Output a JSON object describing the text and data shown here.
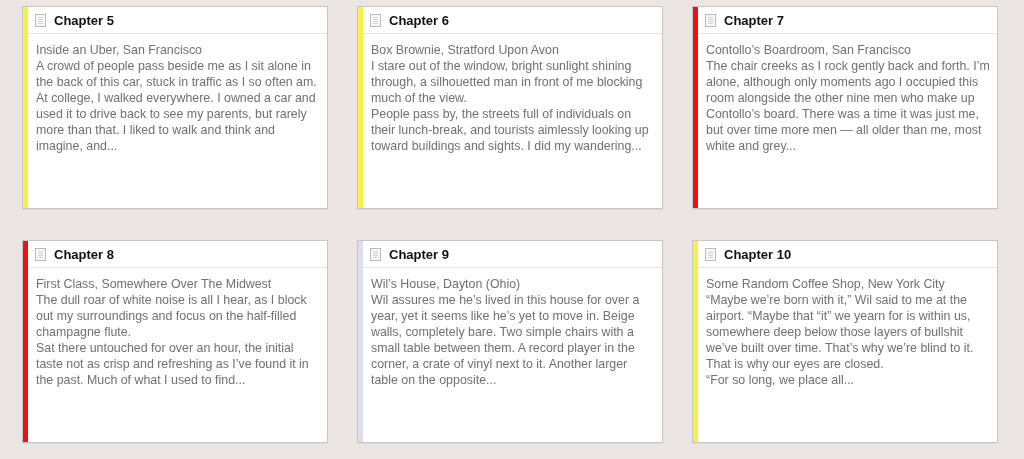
{
  "cards": [
    {
      "title": "Chapter 5",
      "color": "#f7f04a",
      "location": "Inside an Uber, San Francisco",
      "paragraphs": [
        "A crowd of people pass beside me as I sit alone in the back of this car, stuck in traffic as I so often am.",
        "At college, I walked everywhere. I owned a car and used it to drive back to see my parents, but rarely more than that. I liked to walk and think and imagine, and..."
      ]
    },
    {
      "title": "Chapter 6",
      "color": "#f7f04a",
      "location": "Box Brownie, Stratford Upon Avon",
      "paragraphs": [
        "I stare out of the window, bright sunlight shining through, a silhouetted man in front of me blocking much of the view.",
        "People pass by, the streets full of individuals on their lunch-break, and tourists aimlessly looking up toward buildings and sights. I did my wandering..."
      ]
    },
    {
      "title": "Chapter 7",
      "color": "#ef1010",
      "location": "Contollo’s Boardroom, San Francisco",
      "paragraphs": [
        "The chair creeks as I rock gently back and forth. I’m alone, although only moments ago I occupied this room alongside the other nine men who make up Contollo’s board. There was a time it was just me, but over time more men — all older than me, most white and grey..."
      ]
    },
    {
      "title": "Chapter 8",
      "color": "#ef1010",
      "location": "First Class, Somewhere Over The Midwest",
      "paragraphs": [
        "The dull roar of white noise is all I hear, as I block out my surroundings and focus on the half-filled champagne flute.",
        "Sat there untouched for over an hour, the initial taste not as crisp and refreshing as I’ve found it in the past. Much of what I used to find..."
      ]
    },
    {
      "title": "Chapter 9",
      "color": "#dde0ea",
      "location": "Wil’s House, Dayton (Ohio)",
      "paragraphs": [
        "Wil assures me he’s lived in this house for over a year, yet it seems like he’s yet to move in. Beige walls, completely bare. Two simple chairs with a small table between them. A record player in the corner, a crate of vinyl next to it. Another larger table on the opposite..."
      ]
    },
    {
      "title": "Chapter 10",
      "color": "#f7f04a",
      "location": "Some Random Coffee Shop, New York City",
      "paragraphs": [
        "“Maybe we’re born with it,” Wil said to me at the airport. “Maybe that “it” we yearn for is within us, somewhere deep below those layers of bullshit we’ve built over time. That’s why we’re blind to it. That is why our eyes are closed.",
        "“For so long, we place all..."
      ]
    }
  ]
}
